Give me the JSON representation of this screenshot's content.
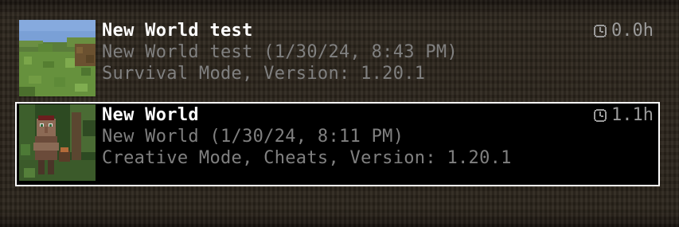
{
  "worlds": [
    {
      "title": "New World test",
      "subtitle": "New World test (1/30/24, 8:43 PM)",
      "details": "Survival Mode, Version: 1.20.1",
      "playtime": "0.0h",
      "thumbnail": "grass-landscape",
      "selected": false
    },
    {
      "title": "New World",
      "subtitle": "New World (1/30/24, 8:11 PM)",
      "details": "Creative Mode, Cheats, Version: 1.20.1",
      "playtime": "1.1h",
      "thumbnail": "villager-forest",
      "selected": true
    }
  ],
  "colors": {
    "title": "#ffffff",
    "subtext": "#808080",
    "selection_border": "#ffffff",
    "selection_bg": "#000000"
  }
}
